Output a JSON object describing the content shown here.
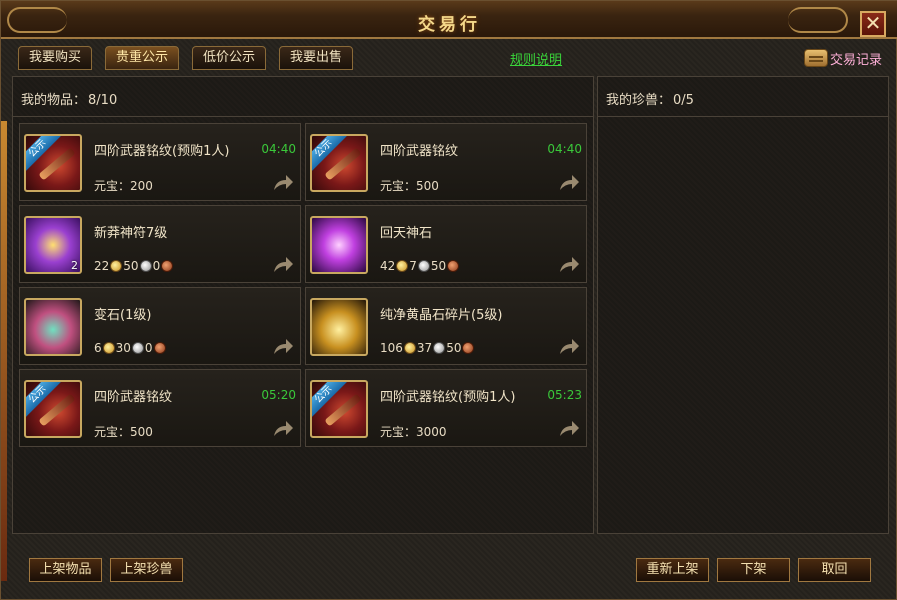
{
  "window": {
    "title": "交易行"
  },
  "tabs": [
    {
      "label": "我要购买",
      "active": false
    },
    {
      "label": "贵重公示",
      "active": true
    },
    {
      "label": "低价公示",
      "active": false
    },
    {
      "label": "我要出售",
      "active": false
    }
  ],
  "rules_link": "规则说明",
  "trade_log": "交易记录",
  "left_panel": {
    "label": "我的物品：",
    "count": "8/10"
  },
  "right_panel": {
    "label": "我的珍兽：",
    "count": "0/5"
  },
  "items": [
    {
      "name": "四阶武器铭纹(预购1人)",
      "timer": "04:40",
      "currency_label": "元宝：",
      "price": "200",
      "ribbon": "公示",
      "icon": "weapon-inscription-icon"
    },
    {
      "name": "四阶武器铭纹",
      "timer": "04:40",
      "currency_label": "元宝：",
      "price": "500",
      "ribbon": "公示",
      "icon": "weapon-inscription-icon"
    },
    {
      "name": "新莽神符7级",
      "timer": "",
      "gold": "22",
      "silver": "50",
      "copper": "0",
      "stack": "2",
      "icon": "talisman-icon"
    },
    {
      "name": "回天神石",
      "timer": "",
      "gold": "42",
      "silver": "7",
      "copper": "50",
      "icon": "divine-stone-icon"
    },
    {
      "name": "变石(1级)",
      "timer": "",
      "gold": "6",
      "silver": "30",
      "copper": "0",
      "icon": "change-stone-icon"
    },
    {
      "name": "纯净黄晶石碎片(5级)",
      "timer": "",
      "gold": "106",
      "silver": "37",
      "copper": "50",
      "icon": "citrine-fragment-icon"
    },
    {
      "name": "四阶武器铭纹",
      "timer": "05:20",
      "currency_label": "元宝：",
      "price": "500",
      "ribbon": "公示",
      "icon": "weapon-inscription-icon"
    },
    {
      "name": "四阶武器铭纹(预购1人)",
      "timer": "05:23",
      "currency_label": "元宝：",
      "price": "3000",
      "ribbon": "公示",
      "icon": "weapon-inscription-icon"
    }
  ],
  "buttons": {
    "list_item": "上架物品",
    "list_pet": "上架珍兽",
    "relist": "重新上架",
    "delist": "下架",
    "cancel": "取回"
  },
  "colors": {
    "timer": "#3ac83a",
    "link": "#3ad43a",
    "title": "#f4d88a",
    "trade_log": "#ffb0d8"
  }
}
